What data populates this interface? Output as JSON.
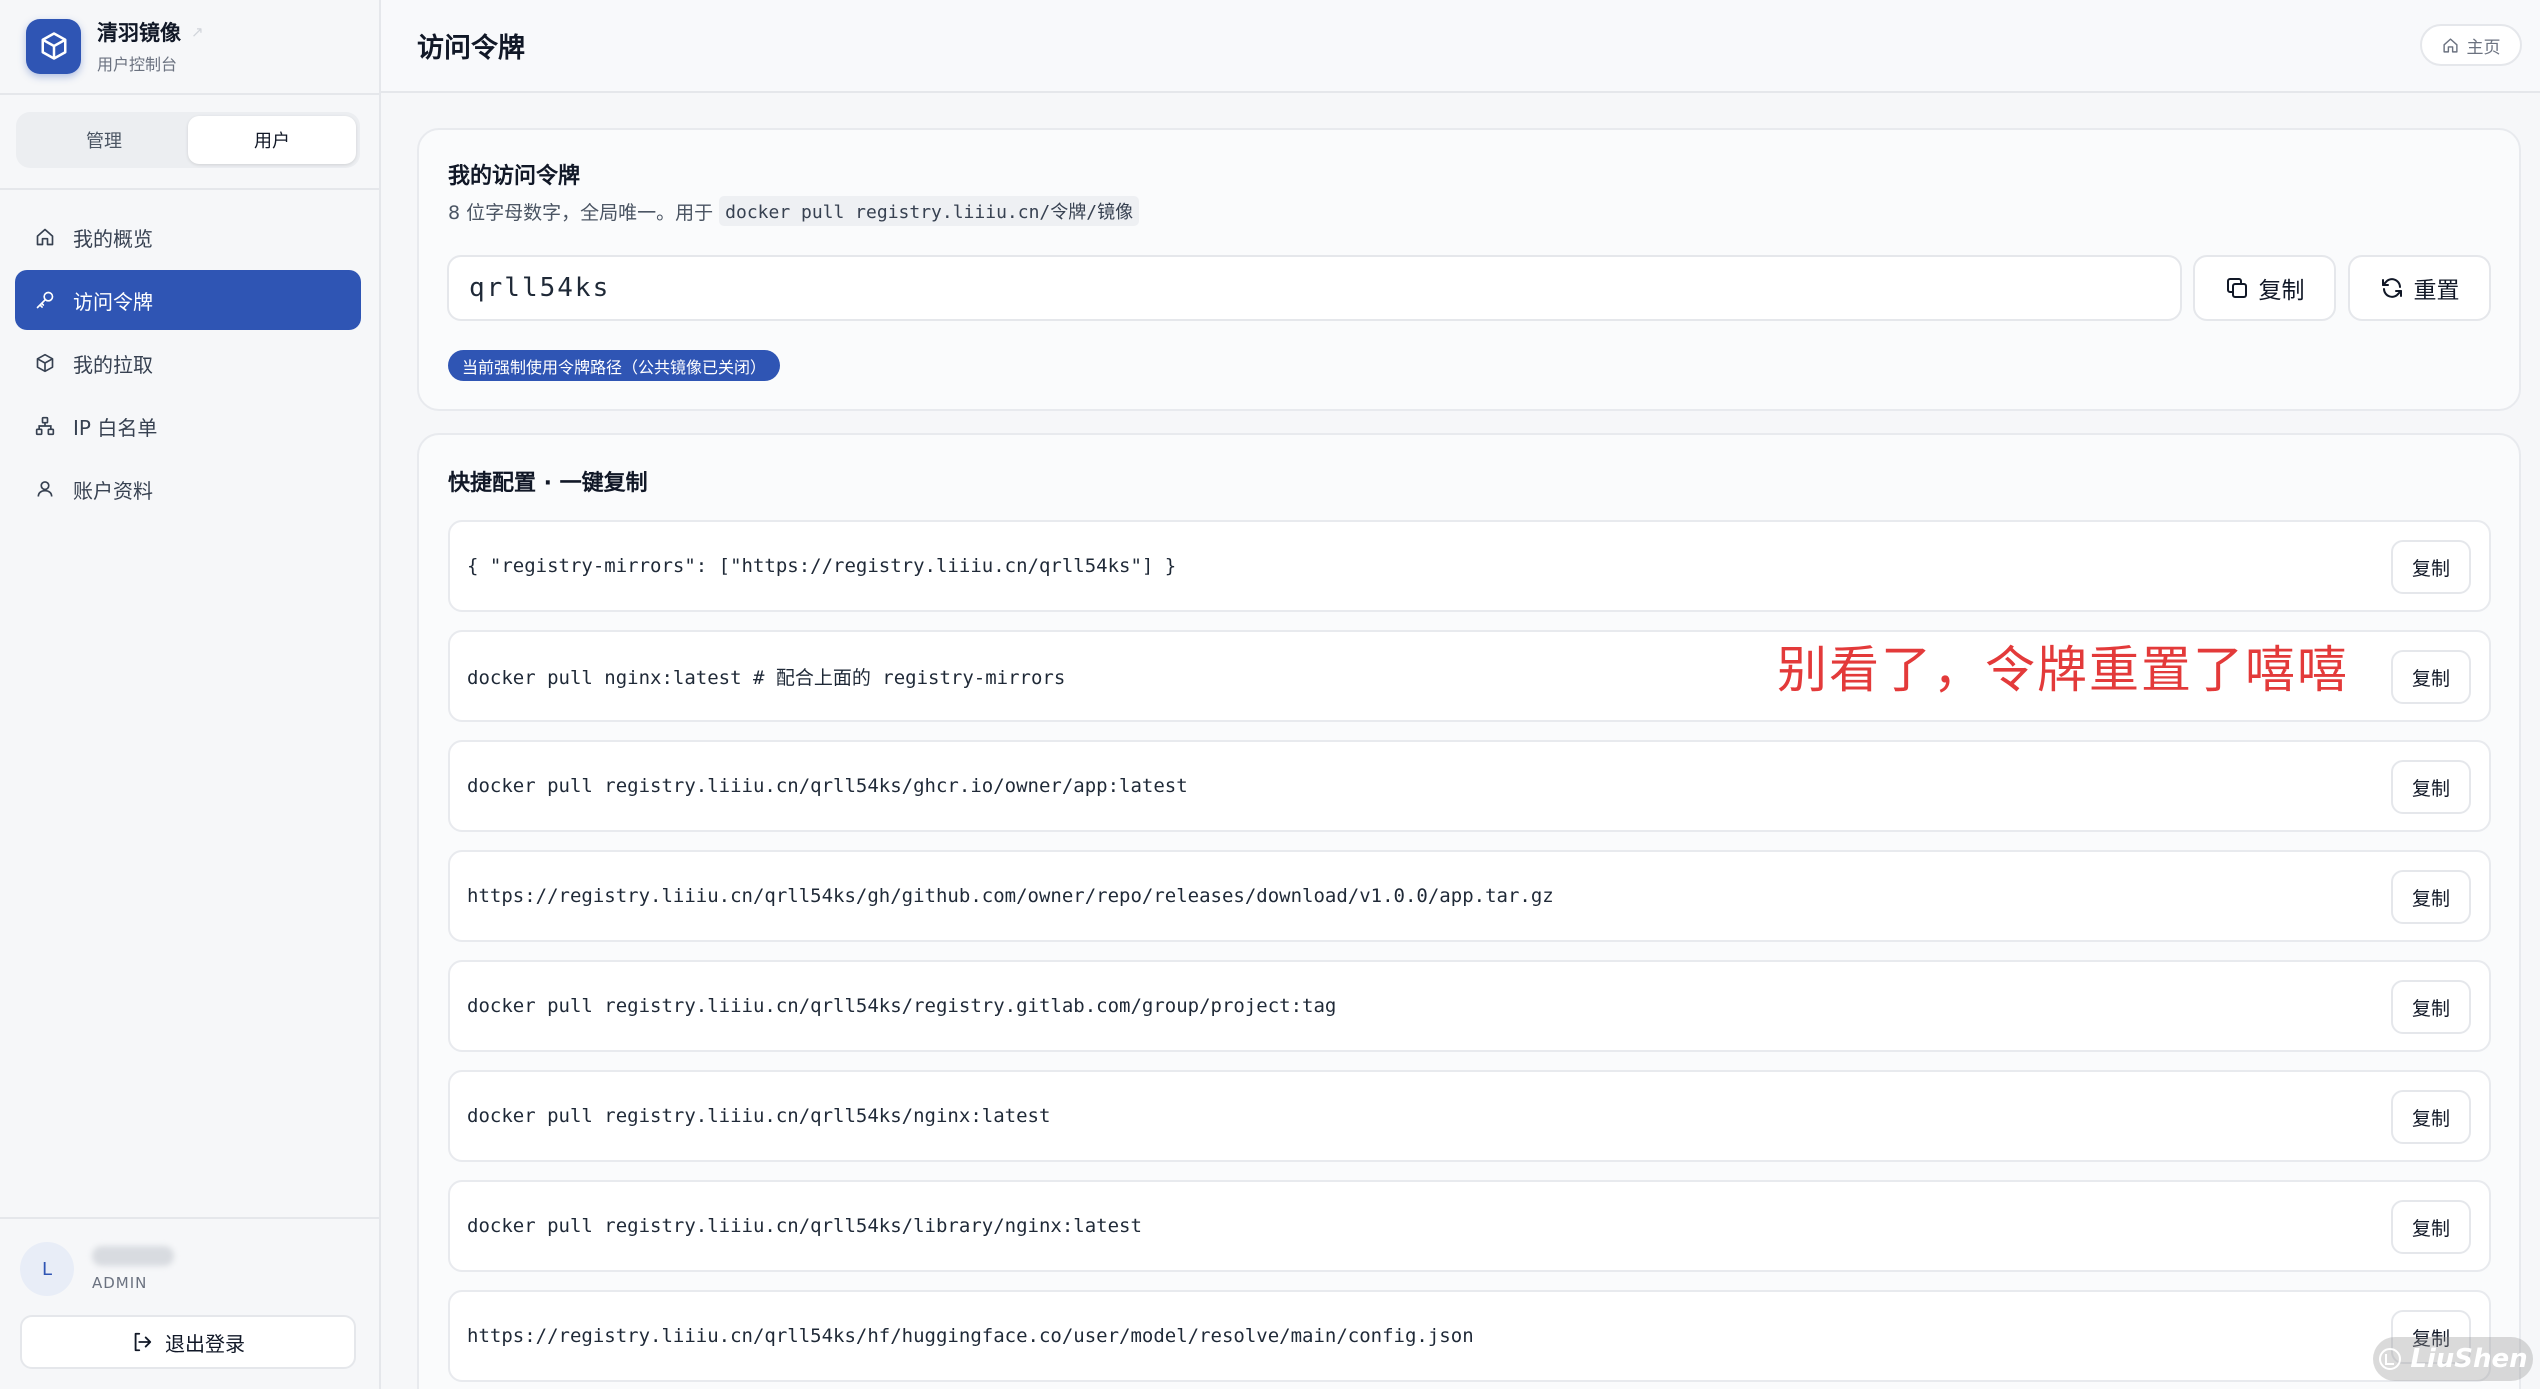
{
  "brand": {
    "title": "清羽镜像",
    "subtitle": "用户控制台",
    "accent": "#2f55b4"
  },
  "segment": {
    "options": [
      "管理",
      "用户"
    ],
    "selected": "用户"
  },
  "sidebar": {
    "items": [
      {
        "label": "我的概览",
        "icon": "home-icon"
      },
      {
        "label": "访问令牌",
        "icon": "key-icon",
        "active": true
      },
      {
        "label": "我的拉取",
        "icon": "package-icon"
      },
      {
        "label": "IP 白名单",
        "icon": "network-icon"
      },
      {
        "label": "账户资料",
        "icon": "user-icon"
      }
    ]
  },
  "user": {
    "initial": "L",
    "role": "ADMIN",
    "logout_label": "退出登录"
  },
  "header": {
    "title": "访问令牌",
    "home_label": "主页"
  },
  "token_card": {
    "title": "我的访问令牌",
    "desc_prefix": "8 位字母数字，全局唯一。用于",
    "desc_code": "docker pull registry.liiiu.cn/令牌/镜像",
    "token_value": "qrll54ks",
    "copy_label": "复制",
    "reset_label": "重置",
    "badge": "当前强制使用令牌路径（公共镜像已关闭）"
  },
  "config_card": {
    "title": "快捷配置 · 一键复制",
    "copy_label": "复制",
    "rows": [
      "{ \"registry-mirrors\": [\"https://registry.liiiu.cn/qrll54ks\"] }",
      "docker pull nginx:latest # 配合上面的 registry-mirrors",
      "docker pull registry.liiiu.cn/qrll54ks/ghcr.io/owner/app:latest",
      "https://registry.liiiu.cn/qrll54ks/gh/github.com/owner/repo/releases/download/v1.0.0/app.tar.gz",
      "docker pull registry.liiiu.cn/qrll54ks/registry.gitlab.com/group/project:tag",
      "docker pull registry.liiiu.cn/qrll54ks/nginx:latest",
      "docker pull registry.liiiu.cn/qrll54ks/library/nginx:latest",
      "https://registry.liiiu.cn/qrll54ks/hf/huggingface.co/user/model/resolve/main/config.json"
    ]
  },
  "annotation": "别看了，令牌重置了嘻嘻",
  "watermark": "LiuShen"
}
